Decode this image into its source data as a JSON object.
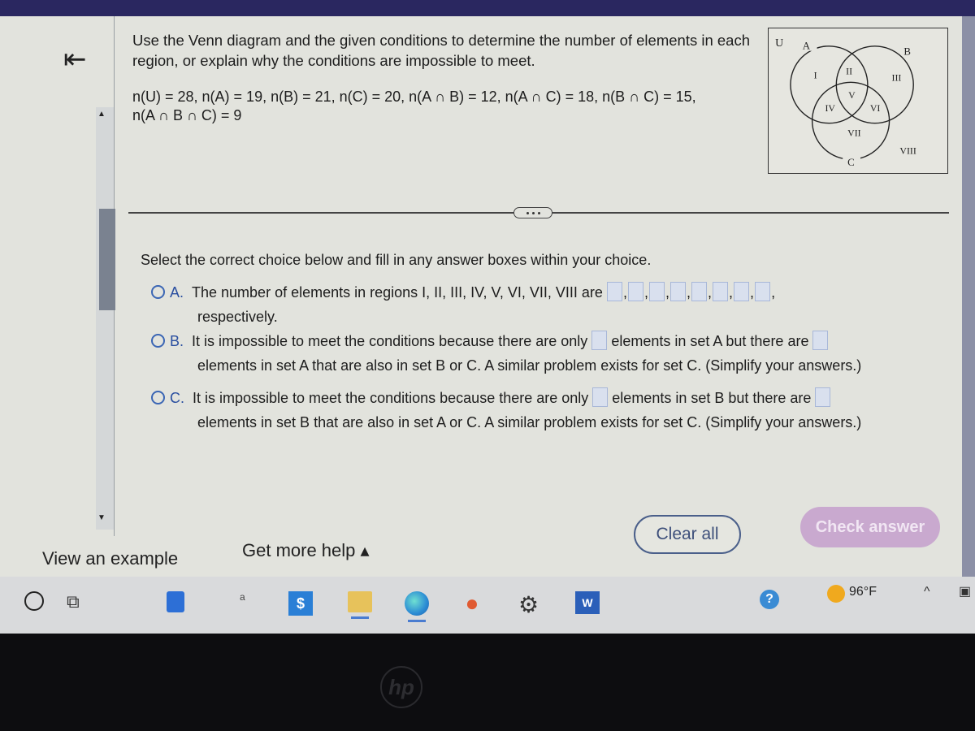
{
  "question": {
    "prompt": "Use the Venn diagram and the given conditions to determine the number of elements in each region, or explain why the conditions are impossible to meet.",
    "conditions_line1": "n(U) = 28,  n(A) = 19,  n(B) = 21,  n(C) = 20,  n(A ∩ B) = 12,  n(A ∩ C) = 18,  n(B ∩ C) = 15,",
    "conditions_line2": "n(A ∩ B ∩ C) = 9"
  },
  "venn": {
    "universe_label": "U",
    "set_labels": {
      "a": "A",
      "b": "B",
      "c": "C"
    },
    "regions": [
      "I",
      "II",
      "III",
      "IV",
      "V",
      "VI",
      "VII",
      "VIII"
    ]
  },
  "instructions": "Select the correct choice below and fill in any answer boxes within your choice.",
  "choices": {
    "a": {
      "letter": "A.",
      "text_before": "The number of elements in regions I, II, III, IV, V, VI, VII, VIII are",
      "text_after": "respectively.",
      "boxes": [
        "",
        "",
        "",
        "",
        "",
        "",
        "",
        ""
      ]
    },
    "b": {
      "letter": "B.",
      "text1": "It is impossible to meet the conditions because there are only",
      "text2": "elements in set A but there are",
      "text3": "elements in set A that are also in set B or C. A similar problem exists for set C. (Simplify your answers.)",
      "box1": "",
      "box2": ""
    },
    "c": {
      "letter": "C.",
      "text1": "It is impossible to meet the conditions because there are only",
      "text2": "elements in set B but there are",
      "text3": "elements in set B that are also in set A or C. A similar problem exists for set C. (Simplify your answers.)",
      "box1": "",
      "box2": ""
    }
  },
  "footer": {
    "view_example": "View an example",
    "get_more_help": "Get more help ▴",
    "clear_all": "Clear all",
    "check_answer": "Check answer"
  },
  "taskbar": {
    "app_a_label": "a",
    "word_label": "W",
    "blue_app_label": "$",
    "weather": "96°F",
    "help_label": "?"
  },
  "bezel": {
    "logo": "hp"
  },
  "colors": {
    "accent_blue": "#2a4fa0",
    "check_answer_bg": "#c9a9cf",
    "answer_box_bg": "#d9e0ee"
  }
}
